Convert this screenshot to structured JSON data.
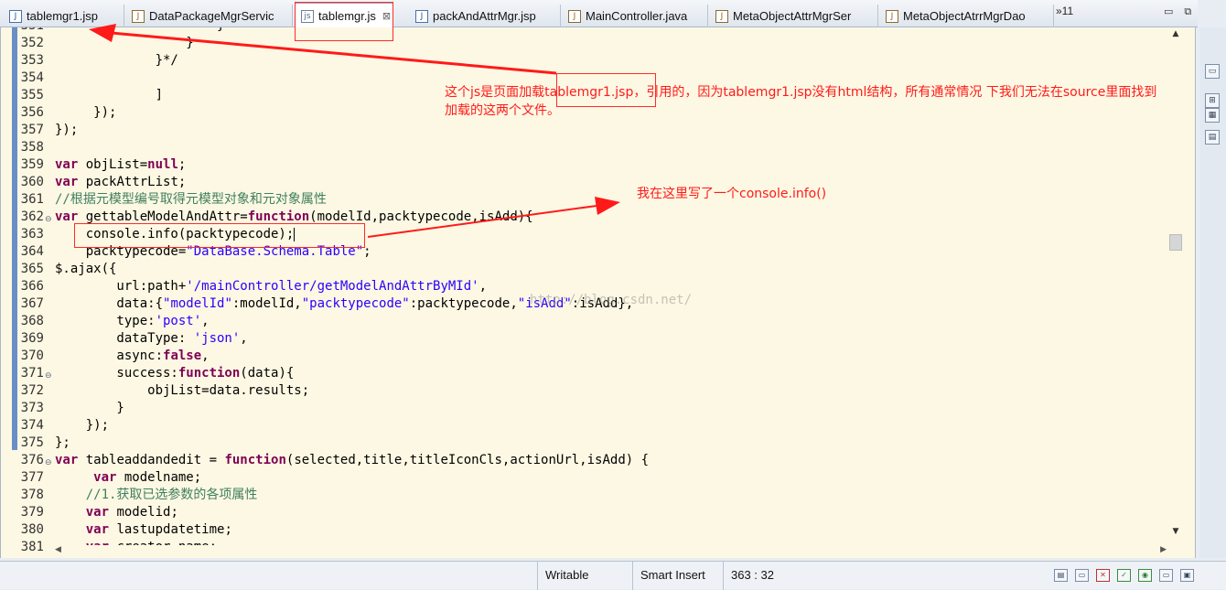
{
  "tabs": [
    {
      "label": "tablemgr1.jsp",
      "icon": "jsp-file-icon",
      "glyph": "J"
    },
    {
      "label": "DataPackageMgrServic",
      "icon": "java-file-icon",
      "glyph": "J"
    },
    {
      "label": "tablemgr.js",
      "icon": "js-file-icon",
      "glyph": "js",
      "close": "⊠"
    },
    {
      "label": "packAndAttrMgr.jsp",
      "icon": "jsp-file-icon",
      "glyph": "J"
    },
    {
      "label": "MainController.java",
      "icon": "java-file-icon",
      "glyph": "J"
    },
    {
      "label": "MetaObjectAttrMgrSer",
      "icon": "java-file-icon",
      "glyph": "J"
    },
    {
      "label": "MetaObjectAtrrMgrDao",
      "icon": "java-file-icon",
      "glyph": "J"
    }
  ],
  "overflow": "»11",
  "window_buttons": {
    "minimize": "▭",
    "maximize": "⧉"
  },
  "lines": [
    {
      "n": "351",
      "html": "                     }"
    },
    {
      "n": "352",
      "html": "                 }"
    },
    {
      "n": "353",
      "html": "             }*/"
    },
    {
      "n": "354",
      "html": ""
    },
    {
      "n": "355",
      "html": "             ]"
    },
    {
      "n": "356",
      "html": "     });"
    },
    {
      "n": "357",
      "html": "});"
    },
    {
      "n": "358",
      "html": ""
    },
    {
      "n": "359",
      "html": "<span class=\"kw\">var</span> objList=<span class=\"kw\">null</span>;"
    },
    {
      "n": "360",
      "html": "<span class=\"kw\">var</span> packAttrList;"
    },
    {
      "n": "361",
      "html": "<span class=\"cm\">//根据元模型编号取得元模型对象和元对象属性</span>"
    },
    {
      "n": "362",
      "marker": "⊖",
      "html": "<span class=\"kw\">var</span> gettableModelAndAttr=<span class=\"kw\">function</span>(modelId,packtypecode,isAdd){"
    },
    {
      "n": "363",
      "html": "    console.info(packtypecode);<span class=\"caret\"></span>"
    },
    {
      "n": "364",
      "html": "    packtypecode=<span class=\"str\">\"DataBase.Schema.Table\"</span>;"
    },
    {
      "n": "365",
      "html": "$.ajax({"
    },
    {
      "n": "366",
      "html": "        url:path+<span class=\"str\">'/mainController/getModelAndAttrByMId'</span>,"
    },
    {
      "n": "367",
      "html": "        data:{<span class=\"str\">\"modelId\"</span>:modelId,<span class=\"str\">\"packtypecode\"</span>:packtypecode,<span class=\"str\">\"isAdd\"</span>:isAdd},"
    },
    {
      "n": "368",
      "html": "        type:<span class=\"str\">'post'</span>,"
    },
    {
      "n": "369",
      "html": "        dataType: <span class=\"str\">'json'</span>,"
    },
    {
      "n": "370",
      "html": "        async:<span class=\"kw\">false</span>,"
    },
    {
      "n": "371",
      "marker": "⊖",
      "html": "        success:<span class=\"kw\">function</span>(data){"
    },
    {
      "n": "372",
      "html": "            objList=data.results;"
    },
    {
      "n": "373",
      "html": "        }"
    },
    {
      "n": "374",
      "html": "    });"
    },
    {
      "n": "375",
      "html": "};"
    },
    {
      "n": "376",
      "marker": "⊖",
      "html": "<span class=\"kw\">var</span> tableaddandedit = <span class=\"kw\">function</span>(selected,title,titleIconCls,actionUrl,isAdd) {"
    },
    {
      "n": "377",
      "html": "     <span class=\"kw\">var</span> modelname;"
    },
    {
      "n": "378",
      "html": "    <span class=\"cm\">//1.获取已选参数的各项属性</span>"
    },
    {
      "n": "379",
      "html": "    <span class=\"kw\">var</span> modelid;"
    },
    {
      "n": "380",
      "html": "    <span class=\"kw\">var</span> lastupdatetime;"
    },
    {
      "n": "381",
      "html": "    <span class=\"kw\">var</span> creator_name;"
    }
  ],
  "watermark": "http://blog.csdn.net/",
  "annotations": {
    "note1_line1": "这个js是页面加载tablemgr1.jsp，引用的，因为tablemgr1.jsp没有html结构，所有通常情况 下我们无法在source里面找到",
    "note1_line2": "加载的这两个文件。",
    "note2": "我在这里写了一个console.info()"
  },
  "status": {
    "writable": "Writable",
    "insert_mode": "Smart Insert",
    "position": "363 : 32"
  },
  "side_tools": [
    "▭",
    "⊞",
    "▦",
    "▤"
  ],
  "status_icons": [
    {
      "glyph": "▤",
      "name": "console-icon",
      "cls": ""
    },
    {
      "glyph": "▭",
      "name": "servers-icon",
      "cls": ""
    },
    {
      "glyph": "✕",
      "name": "problems-icon",
      "cls": "rd"
    },
    {
      "glyph": "✓",
      "name": "tasks-icon",
      "cls": "gr"
    },
    {
      "glyph": "◉",
      "name": "browser-icon",
      "cls": "gr"
    },
    {
      "glyph": "▭",
      "name": "monitor-icon",
      "cls": ""
    },
    {
      "glyph": "▣",
      "name": "outline-icon",
      "cls": ""
    }
  ],
  "colors": {
    "accent_red": "#ff1a1a",
    "editor_bg": "#fdf8e3",
    "keyword": "#7f0055",
    "string": "#2a00ff",
    "comment": "#3f7f5f"
  }
}
